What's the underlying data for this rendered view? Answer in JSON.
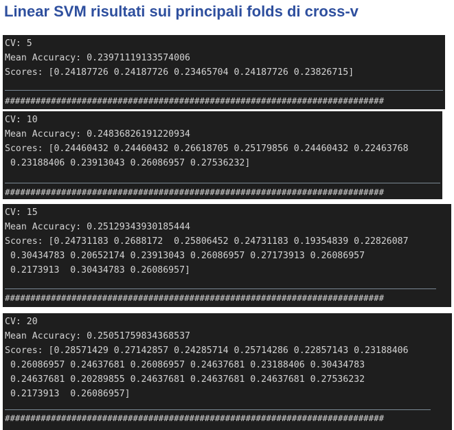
{
  "title": "Linear SVM risultati sui principali folds di cross-v",
  "panels": [
    {
      "cv": "CV: 5",
      "mean": "Mean Accuracy: 0.23971119133574006",
      "scores": [
        "Scores: [0.24187726 0.24187726 0.23465704 0.24187726 0.23826715]"
      ],
      "hashes": "##########################################################################"
    },
    {
      "cv": "CV: 10",
      "mean": "Mean Accuracy: 0.24836826191220934",
      "scores": [
        "Scores: [0.24460432 0.24460432 0.26618705 0.25179856 0.24460432 0.22463768",
        " 0.23188406 0.23913043 0.26086957 0.27536232]"
      ],
      "hashes": "##########################################################################"
    },
    {
      "cv": "CV: 15",
      "mean": "Mean Accuracy: 0.25129343930185444",
      "scores": [
        "Scores: [0.24731183 0.2688172  0.25806452 0.24731183 0.19354839 0.22826087",
        " 0.30434783 0.20652174 0.23913043 0.26086957 0.27173913 0.26086957",
        " 0.2173913  0.30434783 0.26086957]"
      ],
      "hashes": "##########################################################################"
    },
    {
      "cv": "CV: 20",
      "mean": "Mean Accuracy: 0.25051759834368537",
      "scores": [
        "Scores: [0.28571429 0.27142857 0.24285714 0.25714286 0.22857143 0.23188406",
        " 0.26086957 0.24637681 0.26086957 0.24637681 0.23188406 0.30434783",
        " 0.24637681 0.20289855 0.24637681 0.24637681 0.24637681 0.27536232",
        " 0.2173913  0.26086957]"
      ],
      "hashes": "##########################################################################"
    }
  ],
  "colors": {
    "title": "#2e4f9e",
    "panel_bg": "#1e1e1e",
    "text": "#d4d4d4",
    "separator": "#7c8a96"
  }
}
